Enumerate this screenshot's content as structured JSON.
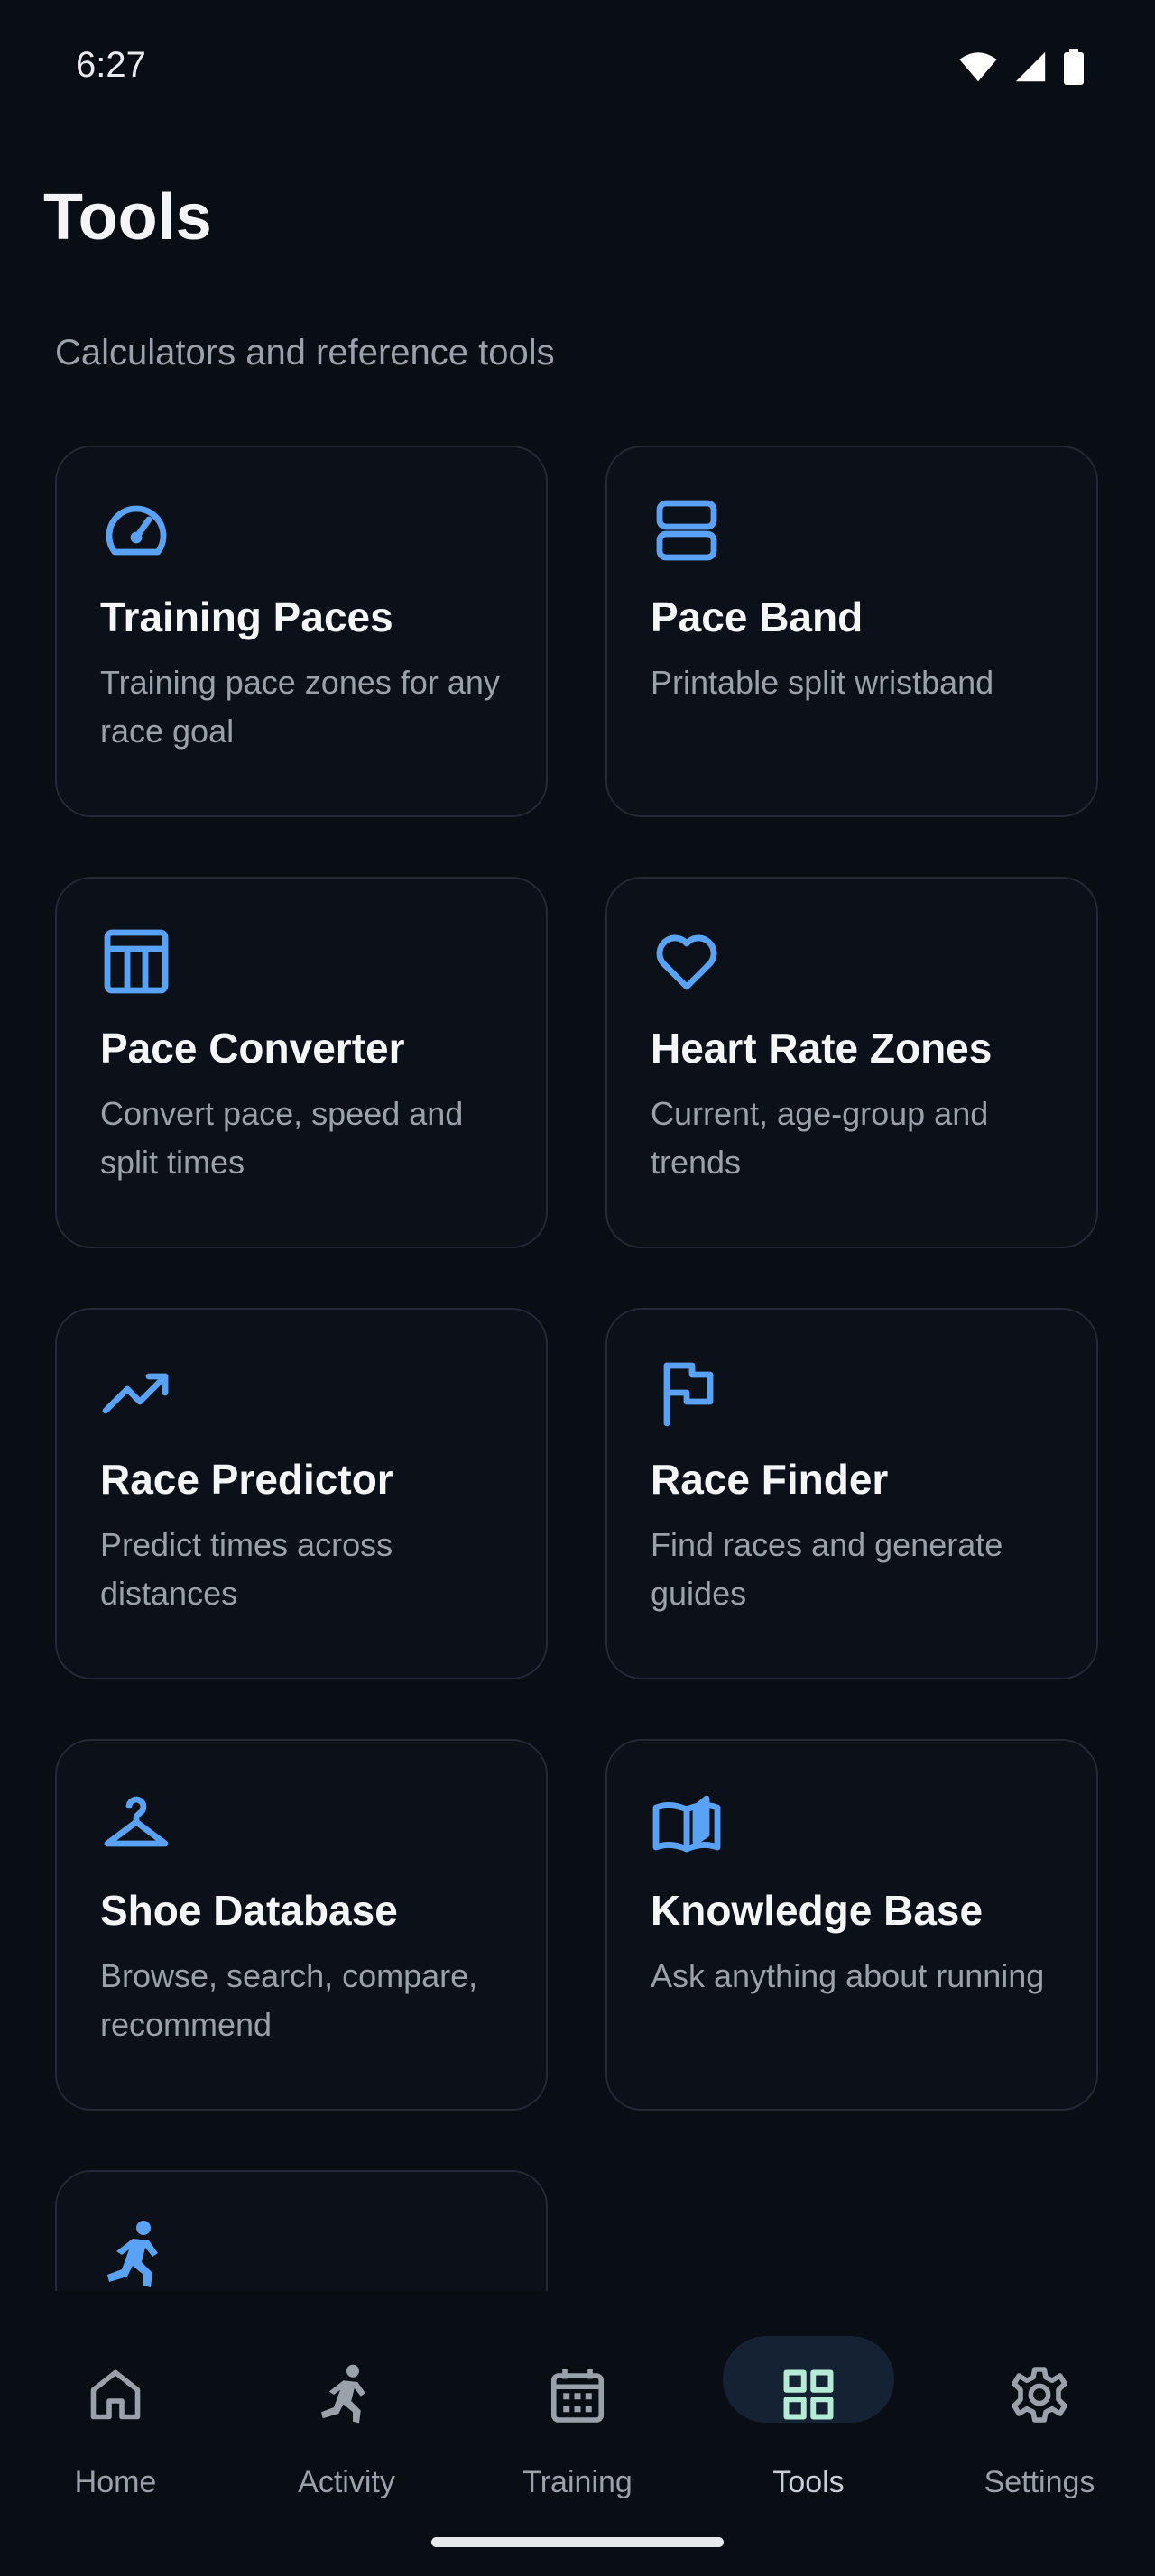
{
  "status_bar": {
    "time": "6:27"
  },
  "header": {
    "title": "Tools",
    "subtitle": "Calculators and reference tools"
  },
  "tools": [
    {
      "title": "Training Paces",
      "description": "Training pace zones for any race goal",
      "icon": "speedometer-icon"
    },
    {
      "title": "Pace Band",
      "description": "Printable split wristband",
      "icon": "band-icon"
    },
    {
      "title": "Pace Converter",
      "description": "Convert pace, speed and split times",
      "icon": "table-icon"
    },
    {
      "title": "Heart Rate Zones",
      "description": "Current, age-group and trends",
      "icon": "heart-icon"
    },
    {
      "title": "Race Predictor",
      "description": "Predict times across distances",
      "icon": "trending-up-icon"
    },
    {
      "title": "Race Finder",
      "description": "Find races and generate guides",
      "icon": "flag-icon"
    },
    {
      "title": "Shoe Database",
      "description": "Browse, search, compare, recommend",
      "icon": "hanger-icon"
    },
    {
      "title": "Knowledge Base",
      "description": "Ask anything about running",
      "icon": "book-icon"
    },
    {
      "title": "",
      "description": "",
      "icon": "runner-icon"
    }
  ],
  "bottom_nav": {
    "items": [
      {
        "label": "Home",
        "icon": "home-icon"
      },
      {
        "label": "Activity",
        "icon": "runner-icon"
      },
      {
        "label": "Training",
        "icon": "calendar-icon"
      },
      {
        "label": "Tools",
        "icon": "grid-icon",
        "active": true
      },
      {
        "label": "Settings",
        "icon": "gear-icon"
      }
    ]
  },
  "colors": {
    "background": "#090d14",
    "accent": "#5aa2f5",
    "card_border": "#232a35",
    "muted_text": "#9aa1ab",
    "active_pill": "#152233",
    "active_icon": "#b6ecd6"
  }
}
